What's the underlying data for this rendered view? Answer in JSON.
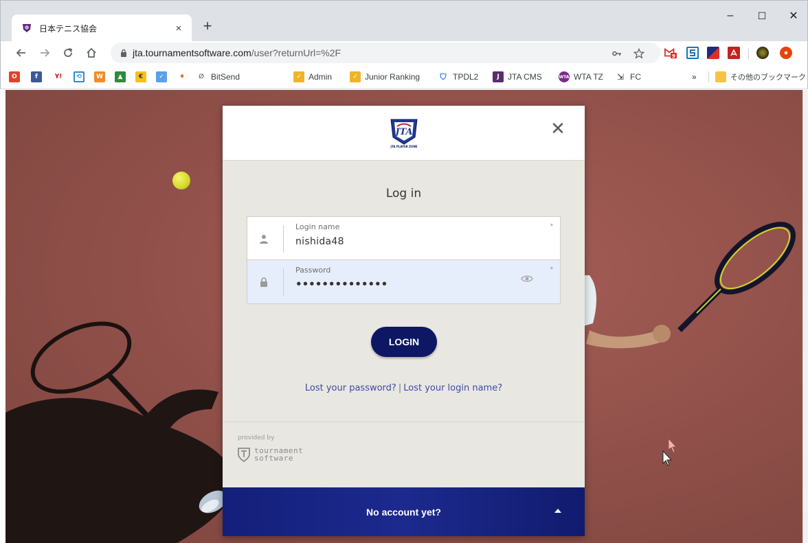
{
  "browser": {
    "tab_title": "日本テニス協会",
    "tab_close": "×",
    "new_tab": "+",
    "url_host": "jta.tournamentsoftware.com",
    "url_path": "/user?returnUrl=%2F",
    "window": {
      "minimize": "–",
      "maximize": "☐",
      "close": "✕"
    },
    "extension_badge": "9"
  },
  "bookmarks": {
    "items": [
      {
        "label": "BitSend"
      },
      {
        "label": "Admin"
      },
      {
        "label": "Junior Ranking"
      },
      {
        "label": "TPDL2"
      },
      {
        "label": "JTA CMS"
      },
      {
        "label": "WTA TZ"
      },
      {
        "label": "FC"
      }
    ],
    "overflow": "»",
    "other_bookmarks": "その他のブックマーク"
  },
  "modal": {
    "close": "✕",
    "logo_caption": "JTA PLAYER ZONE",
    "title": "Log in",
    "login_field": {
      "label": "Login name",
      "value": "nishida48",
      "required_mark": "*"
    },
    "password_field": {
      "label": "Password",
      "value": "••••••••••••••",
      "required_mark": "*"
    },
    "login_button": "LOGIN",
    "lost_password": "Lost your password?",
    "link_separator": "|",
    "lost_login": "Lost your login name?",
    "provided_by": "provided by",
    "brand_line1": "tournament",
    "brand_line2": "software",
    "no_account": "No account yet?"
  },
  "colors": {
    "primary_button": "#0d1763",
    "signup_bar": "#1c2a8e",
    "link": "#3b4aa5",
    "court": "#93524b"
  }
}
